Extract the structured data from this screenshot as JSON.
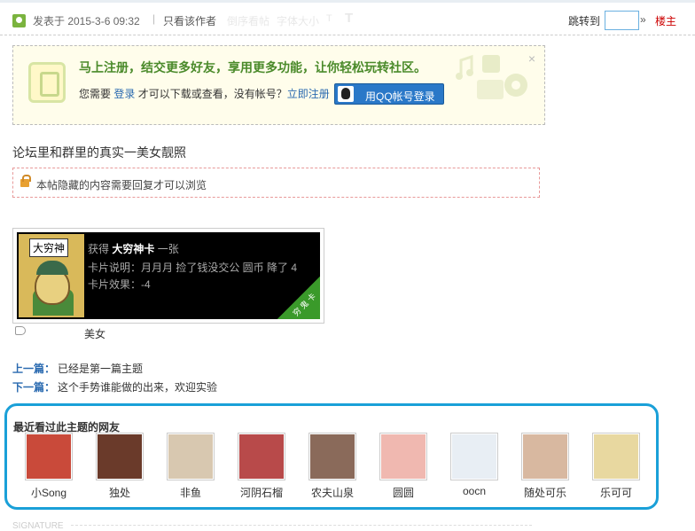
{
  "header": {
    "posted": "发表于 2015-3-6 09:32",
    "separator": "|",
    "only_author": "只看该作者",
    "faded": [
      "倒序看帖",
      "字体大小",
      "T",
      "T"
    ],
    "jump_label": "跳转到",
    "jump_value": "",
    "jump_arrow": "»",
    "floor": "楼主"
  },
  "register": {
    "title": "马上注册，结交更多好友，享用更多功能，让你轻松玩转社区。",
    "need": "您需要 ",
    "login": "登录",
    "mid": " 才可以下载或查看，没有帐号？",
    "register_link": "立即注册",
    "qq_button": "用QQ帐号登录",
    "close": "×"
  },
  "post": {
    "text": "论坛里和群里的真实一美女靓照",
    "hidden_notice": "本帖隐藏的内容需要回复才可以浏览"
  },
  "card": {
    "image_label": "大穷神",
    "gain_prefix": "获得 ",
    "card_name": "大穷神卡",
    "gain_suffix": " 一张",
    "desc": "卡片说明：月月月 捡了钱没交公 圆币 降了 4",
    "effect": "卡片效果：-4",
    "ribbon": "穷 鬼 卡"
  },
  "tag": "美女",
  "nav": {
    "prev_label": "上一篇：",
    "prev_text": "已经是第一篇主题",
    "next_label": "下一篇：",
    "next_text": "这个手势谁能做的出来，欢迎实验"
  },
  "visitors": {
    "title": "最近看过此主题的网友",
    "users": [
      {
        "name": "小Song",
        "color": "#c94a3a"
      },
      {
        "name": "独处",
        "color": "#6a3a2a"
      },
      {
        "name": "非鱼",
        "color": "#d8c8b0"
      },
      {
        "name": "河阴石榴",
        "color": "#b84a4a"
      },
      {
        "name": "农夫山泉",
        "color": "#8a6a5a"
      },
      {
        "name": "圆圆",
        "color": "#f0b8b0"
      },
      {
        "name": "oocn",
        "color": "#e8eef4"
      },
      {
        "name": "随处可乐",
        "color": "#d8b8a0"
      },
      {
        "name": "乐可可",
        "color": "#e8d8a0"
      }
    ]
  },
  "signature": "SIGNATURE"
}
